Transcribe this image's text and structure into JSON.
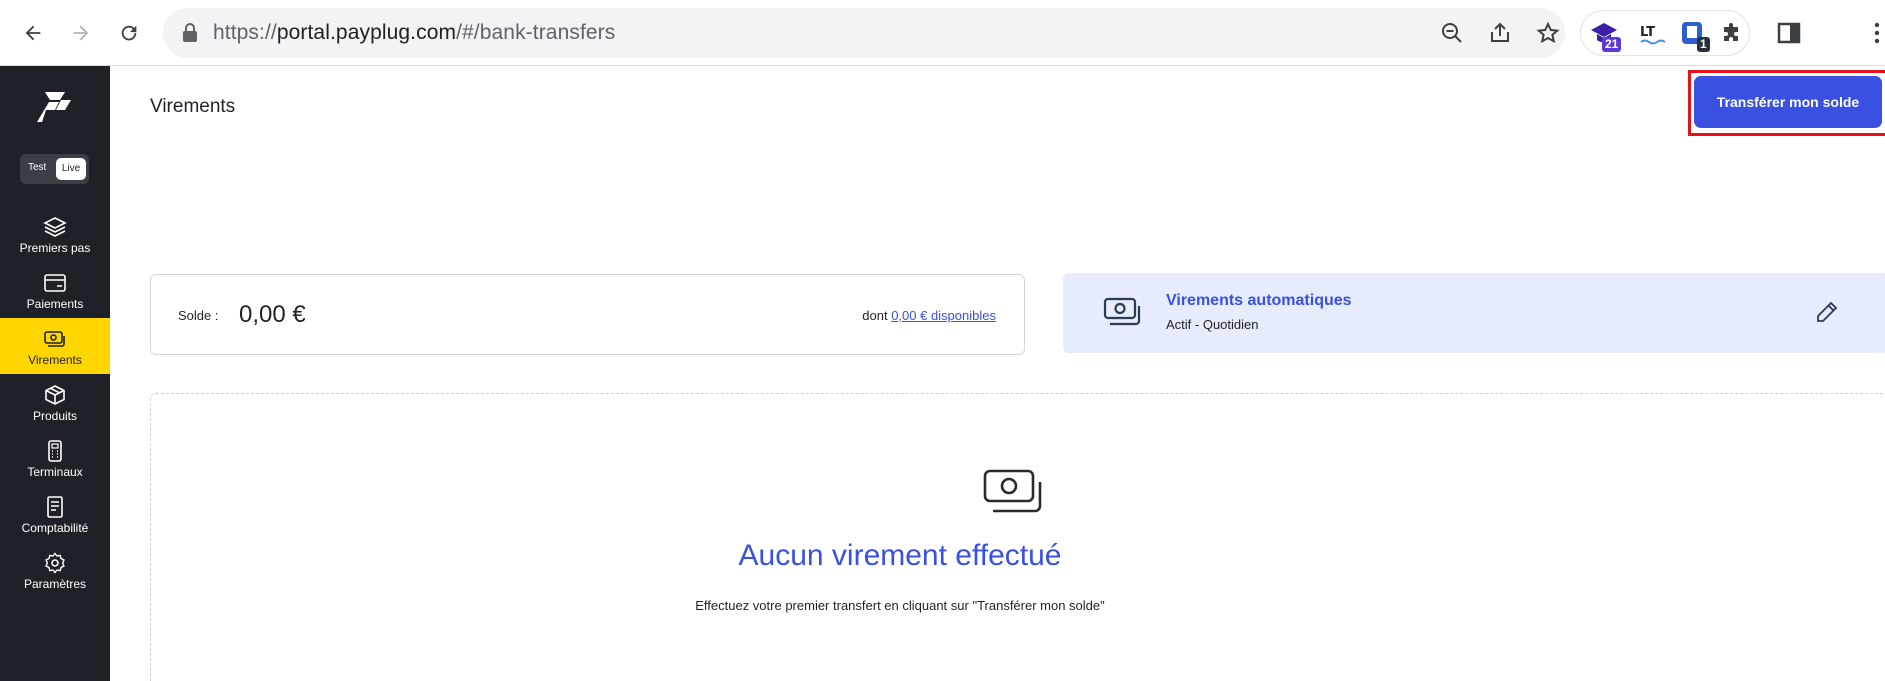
{
  "browser": {
    "url_prefix": "https://",
    "url_host": "portal.payplug.com",
    "url_path": "/#/bank-transfers",
    "extensions": [
      {
        "name": "graduation-cap-extension",
        "badge": "21",
        "badge_color": "#5b3ad6"
      },
      {
        "name": "languagetool-extension",
        "badge": ""
      },
      {
        "name": "bookmark-extension",
        "badge": "1",
        "badge_color": "#263238"
      }
    ]
  },
  "sidebar": {
    "mode_toggle": {
      "test_label": "Test",
      "live_label": "Live",
      "selected": "Live"
    },
    "items": [
      {
        "id": "premiers-pas",
        "label": "Premiers pas",
        "icon": "layers-icon"
      },
      {
        "id": "paiements",
        "label": "Paiements",
        "icon": "card-icon"
      },
      {
        "id": "virements",
        "label": "Virements",
        "icon": "cash-icon",
        "active": true
      },
      {
        "id": "produits",
        "label": "Produits",
        "icon": "box-icon"
      },
      {
        "id": "terminaux",
        "label": "Terminaux",
        "icon": "terminal-icon"
      },
      {
        "id": "comptabilite",
        "label": "Comptabilité",
        "icon": "ledger-icon"
      },
      {
        "id": "parametres",
        "label": "Paramètres",
        "icon": "gear-icon"
      }
    ]
  },
  "main": {
    "title": "Virements",
    "transfer_button": "Transférer mon solde",
    "balance": {
      "label": "Solde :",
      "amount": "0,00 €",
      "available_prefix": "dont",
      "available_link": "0,00 € disponibles"
    },
    "auto_transfers": {
      "title": "Virements automatiques",
      "status": "Actif - Quotidien"
    },
    "empty_state": {
      "title": "Aucun virement effectué",
      "subtitle": "Effectuez votre premier transfert en cliquant sur \"Transférer mon solde\""
    }
  },
  "colors": {
    "accent": "#3950e0",
    "sidebar_bg": "#1e2228",
    "active_item": "#ffd600",
    "highlight": "#e3121b"
  }
}
